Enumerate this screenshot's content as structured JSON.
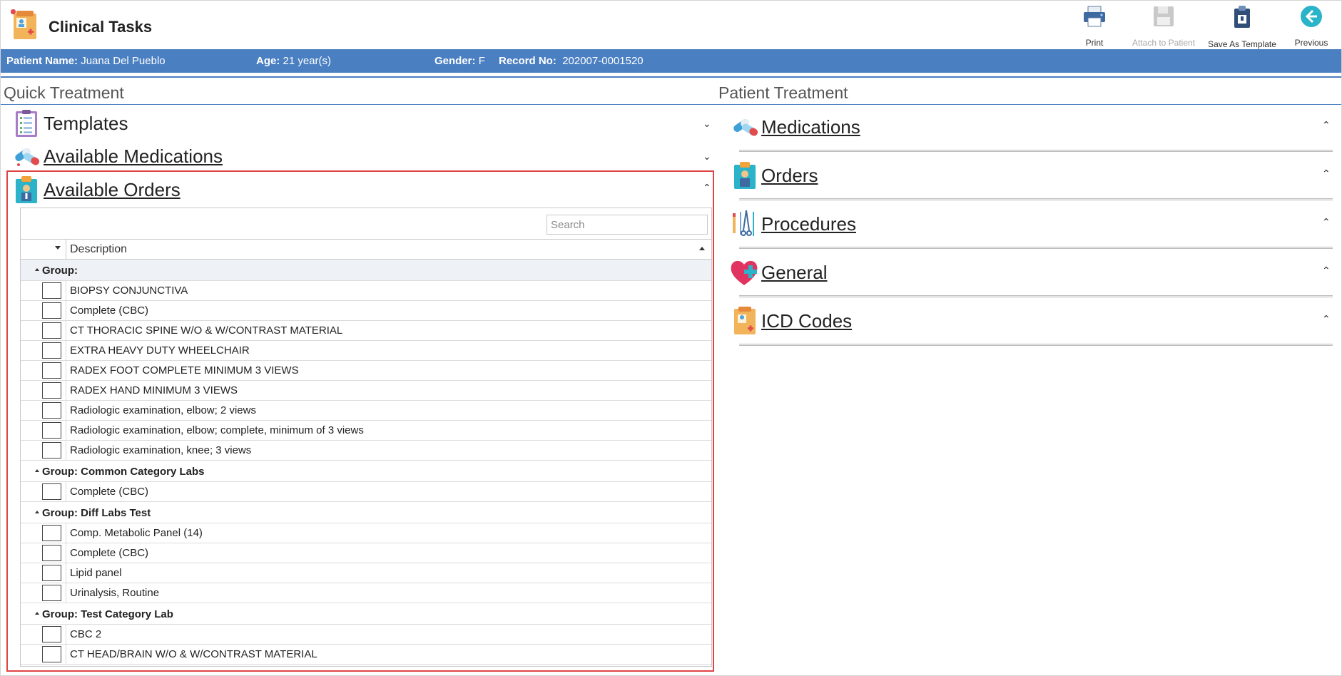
{
  "app": {
    "title": "Clinical Tasks"
  },
  "toolbar": {
    "print": "Print",
    "attach": "Attach to Patient",
    "save_template": "Save As Template",
    "previous": "Previous"
  },
  "patient": {
    "name_label": "Patient Name:",
    "name": "Juana Del Pueblo",
    "age_label": "Age:",
    "age": "21 year(s)",
    "gender_label": "Gender:",
    "gender": "F",
    "record_label": "Record No:",
    "record": "202007-0001520"
  },
  "quick_treatment": {
    "title": "Quick Treatment",
    "templates_label": "Templates",
    "available_medications_label": "Available Medications",
    "available_orders_label": "Available Orders"
  },
  "orders_grid": {
    "search_placeholder": "Search",
    "column_description": "Description",
    "groups": [
      {
        "label": "Group:",
        "items": [
          "BIOPSY CONJUNCTIVA",
          "Complete (CBC)",
          "CT THORACIC SPINE W/O & W/CONTRAST MATERIAL",
          "EXTRA HEAVY DUTY WHEELCHAIR",
          "RADEX FOOT COMPLETE MINIMUM 3 VIEWS",
          "RADEX HAND MINIMUM 3 VIEWS",
          "Radiologic examination, elbow; 2 views",
          "Radiologic examination, elbow; complete, minimum of 3 views",
          "Radiologic examination, knee; 3 views"
        ]
      },
      {
        "label": "Group: Common Category Labs",
        "items": [
          "Complete (CBC)"
        ]
      },
      {
        "label": "Group: Diff Labs Test",
        "items": [
          "Comp. Metabolic Panel (14)",
          "Complete (CBC)",
          "Lipid panel",
          "Urinalysis, Routine"
        ]
      },
      {
        "label": "Group: Test Category Lab",
        "items": [
          "CBC 2",
          "CT HEAD/BRAIN W/O & W/CONTRAST MATERIAL"
        ]
      }
    ]
  },
  "patient_treatment": {
    "title": "Patient Treatment",
    "sections": [
      "Medications",
      "Orders",
      "Procedures",
      "General",
      "ICD Codes"
    ]
  },
  "colors": {
    "accent_blue": "#4a7fc1",
    "highlight_red": "#e04444"
  }
}
